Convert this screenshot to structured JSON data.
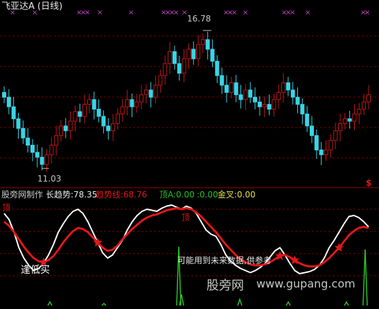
{
  "colors": {
    "bg": "#000000",
    "grid": "#7a0000",
    "up": "#c01818",
    "down": "#39d4e6",
    "marker": "#d040d0",
    "white_line": "#ffffff",
    "red_line": "#e01818",
    "green": "#27c427",
    "yellow": "#e6e04a",
    "gray_text": "#c8c8c8"
  },
  "price_panel": {
    "title": "飞亚达A (日线)",
    "high_label": "16.78",
    "low_label": "11.03",
    "corner_mark": "$",
    "top_markers": [
      "x",
      "x",
      "xxx",
      "x",
      "x",
      "xxxx",
      "x",
      "xxx",
      "x",
      "xxx",
      "x",
      "xx"
    ]
  },
  "indicator_header": {
    "source_label": "股旁网制作",
    "long_trend_label": "长趋势:78.35",
    "trend_line_label": "趋势线:68.76",
    "top_a_label": "顶A:0.00",
    "zero_label": ":0.00",
    "golden_cross_label": "金叉:0.00"
  },
  "annotations": {
    "top_left": "顶",
    "mid_top": "顶",
    "buy_low": "逢低买",
    "future_note": "可能用到未来数据,供参考"
  },
  "watermark": {
    "cn": "股旁网",
    "url": "www.gupang.com"
  },
  "chart_data": [
    {
      "type": "candlestick",
      "title": "飞亚达A (日线)",
      "high_annotation": 16.78,
      "low_annotation": 11.03,
      "ylim": [
        10.6,
        17.3
      ],
      "closes": [
        14.0,
        13.6,
        13.1,
        12.7,
        12.3,
        12.0,
        11.7,
        11.5,
        11.2,
        11.6,
        12.0,
        12.4,
        12.8,
        12.6,
        13.0,
        13.4,
        13.2,
        13.7,
        13.9,
        13.5,
        13.2,
        12.8,
        12.6,
        12.9,
        13.3,
        13.6,
        13.9,
        13.6,
        13.8,
        14.1,
        14.3,
        14.0,
        14.5,
        14.9,
        15.4,
        15.9,
        15.4,
        15.0,
        15.6,
        16.0,
        15.6,
        16.2,
        16.4,
        16.0,
        15.5,
        14.9,
        14.5,
        14.2,
        14.6,
        14.1,
        13.9,
        14.3,
        14.0,
        13.8,
        13.6,
        13.7,
        13.5,
        13.9,
        14.2,
        14.6,
        14.3,
        14.0,
        13.7,
        13.3,
        12.8,
        12.4,
        11.8,
        11.6,
        11.8,
        12.2,
        12.6,
        12.9,
        13.1,
        13.0,
        13.3,
        13.5,
        13.8,
        14.1
      ],
      "series_colors": {
        "up": "#c01818",
        "down": "#39d4e6"
      }
    },
    {
      "type": "line",
      "series": [
        {
          "name": "长趋势",
          "color": "#ffffff",
          "values": [
            88,
            82,
            70,
            55,
            45,
            38,
            33,
            35,
            40,
            48,
            58,
            70,
            78,
            85,
            90,
            92,
            88,
            80,
            70,
            60,
            50,
            45,
            48,
            55,
            62,
            72,
            80,
            86,
            90,
            92,
            91,
            90,
            93,
            95,
            96,
            94,
            92,
            95,
            93,
            88,
            80,
            72,
            68,
            66,
            58,
            48,
            42,
            38,
            35,
            33,
            31,
            33,
            36,
            40,
            46,
            52,
            55,
            48,
            40,
            33,
            30,
            31,
            32,
            34,
            38,
            45,
            55,
            62,
            70,
            78,
            85,
            86,
            84,
            80,
            75
          ]
        },
        {
          "name": "趋势线",
          "color": "#e01818",
          "values": [
            80,
            76,
            70,
            63,
            56,
            50,
            45,
            42,
            41,
            43,
            47,
            53,
            60,
            66,
            71,
            74,
            73,
            70,
            65,
            60,
            55,
            52,
            53,
            57,
            63,
            68,
            73,
            77,
            81,
            84,
            86,
            87,
            89,
            91,
            92,
            93,
            92,
            93,
            92,
            89,
            85,
            80,
            75,
            70,
            64,
            58,
            53,
            48,
            44,
            41,
            39,
            38,
            38,
            39,
            41,
            44,
            47,
            48,
            46,
            43,
            40,
            38,
            37,
            37,
            38,
            41,
            45,
            50,
            55,
            61,
            67,
            71,
            74,
            75,
            74
          ]
        }
      ],
      "ylim": [
        0,
        100
      ],
      "stars_at_index": [
        8,
        19,
        56,
        59,
        68
      ]
    }
  ]
}
